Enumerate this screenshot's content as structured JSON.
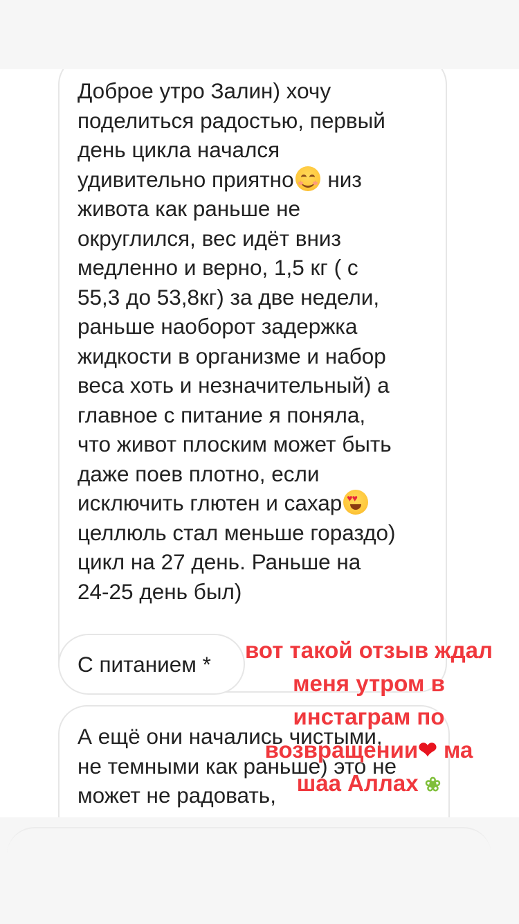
{
  "messages": [
    {
      "lines": [
        "Доброе утро Залин) хочу",
        "поделиться радостью, первый",
        "день цикла начался",
        "удивительно приятно",
        "низ",
        "живота как раньше не",
        "округлился, вес идёт вниз",
        "медленно и верно, 1,5 кг ( с",
        "55,3 до 53,8кг) за две недели,",
        "раньше наоборот задержка",
        "жидкости в организме и набор",
        "веса хоть и незначительный) а",
        "главное с питание я поняла,",
        "что живот плоским может быть",
        "даже поев плотно, если",
        "исключить глютен и сахар",
        "целлюль стал меньше гораздо)",
        "цикл на 27 день. Раньше на",
        "24-25 день был)"
      ]
    },
    {
      "text": "С питанием *"
    },
    {
      "lines": [
        "А ещё они начались чистыми,",
        "не темными как раньше) это не",
        "может не радовать,"
      ]
    }
  ],
  "overlay": {
    "line1": "вот такой отзыв ждал",
    "line2": "меня утром в",
    "line3": "инстаграм по",
    "line4a": "возвращении",
    "line4b": "ма",
    "line5": "шаа Аллах"
  },
  "icons": {
    "smile": "smiling-face-icon",
    "heart_eyes": "heart-eyes-face-icon",
    "heart": "red-heart-icon",
    "leaf": "herb-icon"
  },
  "colors": {
    "overlay_text": "#f0383d",
    "bubble_border": "#e6e6e6",
    "message_text": "#222222"
  }
}
